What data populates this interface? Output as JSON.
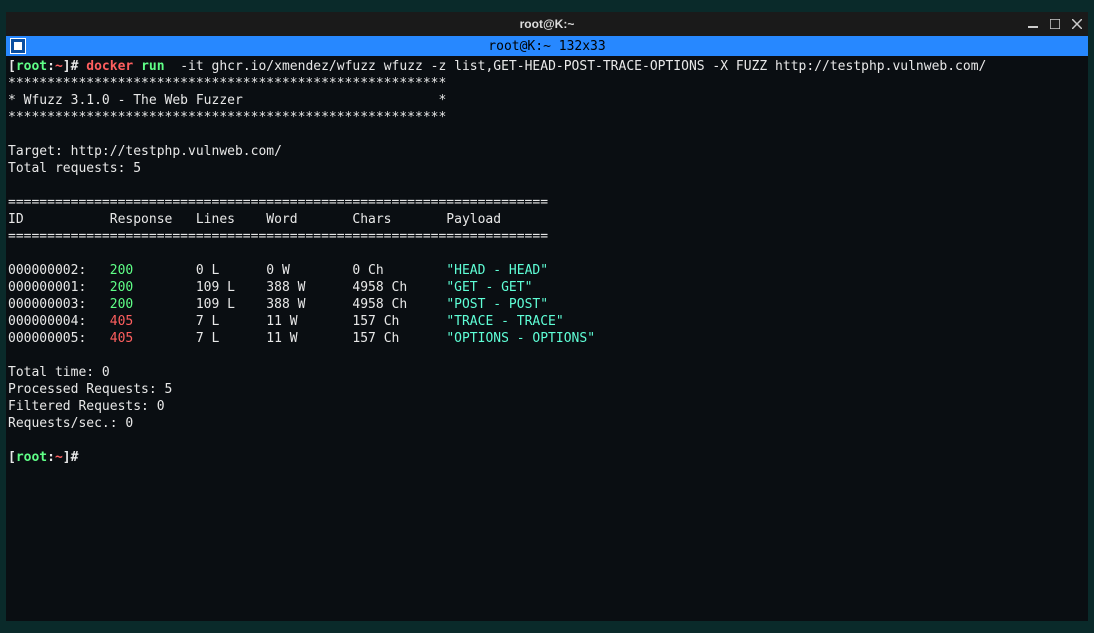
{
  "window": {
    "title": "root@K:~",
    "subtitle": "root@K:~ 132x33"
  },
  "prompt": {
    "open_bracket": "[",
    "user": "root",
    "colon": ":",
    "path": "~",
    "close": "]#",
    "hash_only": " "
  },
  "cmd": {
    "docker": "docker",
    "run": "run",
    "rest": "  -it ghcr.io/xmendez/wfuzz wfuzz -z list,GET-HEAD-POST-TRACE-OPTIONS -X FUZZ http://testphp.vulnweb.com/"
  },
  "banner": {
    "stars1": "********************************************************",
    "title_line_open": "* Wfuzz 3.1.0 - The Web Fuzzer",
    "title_line_pad": "                         *",
    "stars2": "********************************************************"
  },
  "target_line": "Target: http://testphp.vulnweb.com/",
  "total_req_line": "Total requests: 5",
  "sep": "=====================================================================",
  "header_line": "ID           Response   Lines    Word       Chars       Payload",
  "rows": [
    {
      "id": "000000002:",
      "resp": "200",
      "lines": "0 L",
      "word": "0 W",
      "chars": "0 Ch",
      "payload": "\"HEAD - HEAD\""
    },
    {
      "id": "000000001:",
      "resp": "200",
      "lines": "109 L",
      "word": "388 W",
      "chars": "4958 Ch",
      "payload": "\"GET - GET\""
    },
    {
      "id": "000000003:",
      "resp": "200",
      "lines": "109 L",
      "word": "388 W",
      "chars": "4958 Ch",
      "payload": "\"POST - POST\""
    },
    {
      "id": "000000004:",
      "resp": "405",
      "lines": "7 L",
      "word": "11 W",
      "chars": "157 Ch",
      "payload": "\"TRACE - TRACE\""
    },
    {
      "id": "000000005:",
      "resp": "405",
      "lines": "7 L",
      "word": "11 W",
      "chars": "157 Ch",
      "payload": "\"OPTIONS - OPTIONS\""
    }
  ],
  "summary": {
    "total_time": "Total time: 0",
    "processed": "Processed Requests: 5",
    "filtered": "Filtered Requests: 0",
    "rps": "Requests/sec.: 0"
  }
}
